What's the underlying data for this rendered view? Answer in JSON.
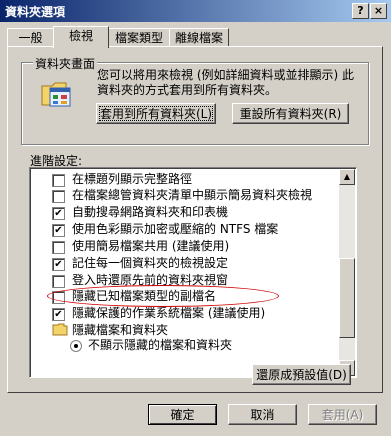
{
  "window": {
    "title": "資料夾選項",
    "help_glyph": "?",
    "close_glyph": "×"
  },
  "tabs": [
    {
      "label": "一般"
    },
    {
      "label": "檢視"
    },
    {
      "label": "檔案類型"
    },
    {
      "label": "離線檔案"
    }
  ],
  "folder_views": {
    "group_title": "資料夾畫面",
    "description": "您可以將用來檢視 (例如詳細資料或並排顯示) 此資料夾的方式套用到所有資料夾。",
    "apply_all_button": "套用到所有資料夾(L)",
    "reset_all_button": "重設所有資料夾(R)",
    "icon": "folder-view-icon"
  },
  "advanced": {
    "label": "進階設定:",
    "items": [
      {
        "type": "checkbox",
        "checked": false,
        "label": "在標題列顯示完整路徑"
      },
      {
        "type": "checkbox",
        "checked": false,
        "label": "在檔案總管資料夾清單中顯示簡易資料夾檢視"
      },
      {
        "type": "checkbox",
        "checked": true,
        "label": "自動搜尋網路資料夾和印表機"
      },
      {
        "type": "checkbox",
        "checked": true,
        "label": "使用色彩顯示加密或壓縮的 NTFS 檔案"
      },
      {
        "type": "checkbox",
        "checked": false,
        "label": "使用簡易檔案共用 (建議使用)"
      },
      {
        "type": "checkbox",
        "checked": true,
        "label": "記住每一個資料夾的檢視設定"
      },
      {
        "type": "checkbox",
        "checked": false,
        "label": "登入時還原先前的資料夾視窗"
      },
      {
        "type": "checkbox",
        "checked": false,
        "label": "隱藏已知檔案類型的副檔名"
      },
      {
        "type": "checkbox",
        "checked": true,
        "label": "隱藏保護的作業系統檔案 (建議使用)"
      },
      {
        "type": "folder",
        "label": "隱藏檔案和資料夾"
      },
      {
        "type": "radio",
        "checked": true,
        "label": "不顯示隱藏的檔案和資料夾"
      }
    ],
    "checkmark": "✔",
    "scroll_up": "▲",
    "scroll_down": "▼"
  },
  "restore_defaults_button": "還原成預設值(D)",
  "footer": {
    "ok": "確定",
    "cancel": "取消",
    "apply": "套用(A)"
  },
  "colors": {
    "title_start": "#0a246a",
    "title_end": "#a6caf0",
    "highlight_ellipse": "#d00000",
    "face": "#d4d0c8"
  }
}
